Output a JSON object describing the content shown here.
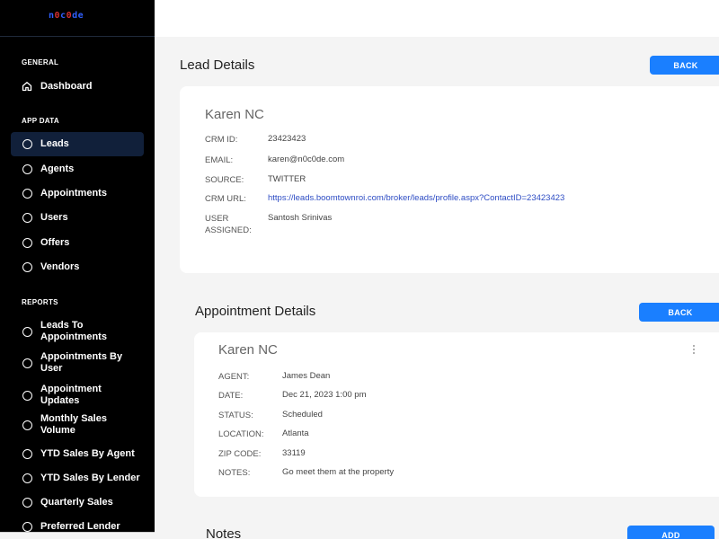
{
  "logo": {
    "p1": "n",
    "p2": "0",
    "p3": "c",
    "p4": "0",
    "p5": "de"
  },
  "sidebar": {
    "general_heading": "GENERAL",
    "dashboard": "Dashboard",
    "app_data_heading": "APP DATA",
    "app_items": [
      "Leads",
      "Agents",
      "Appointments",
      "Users",
      "Offers",
      "Vendors"
    ],
    "reports_heading": "REPORTS",
    "report_items": [
      "Leads To Appointments",
      "Appointments By User",
      "Appointment Updates",
      "Monthly Sales Volume",
      "YTD Sales By Agent",
      "YTD Sales By Lender",
      "Quarterly Sales",
      "Preferred Lender"
    ]
  },
  "lead": {
    "title": "Lead Details",
    "back_label": "BACK",
    "name": "Karen NC",
    "fields": [
      {
        "label": "CRM ID:",
        "value": "23423423"
      },
      {
        "label": "EMAIL:",
        "value": "karen@n0c0de.com"
      },
      {
        "label": "SOURCE:",
        "value": "TWITTER"
      },
      {
        "label": "CRM URL:",
        "value": "https://leads.boomtownroi.com/broker/leads/profile.aspx?ContactID=23423423"
      },
      {
        "label": "USER ASSIGNED:",
        "value": "Santosh Srinivas"
      }
    ]
  },
  "appointment": {
    "title": "Appointment Details",
    "back_label": "BACK",
    "name": "Karen NC",
    "fields": [
      {
        "label": "AGENT:",
        "value": "James Dean"
      },
      {
        "label": "DATE:",
        "value": "Dec 21, 2023 1:00 pm"
      },
      {
        "label": "STATUS:",
        "value": "Scheduled"
      },
      {
        "label": "LOCATION:",
        "value": "Atlanta"
      },
      {
        "label": "ZIP CODE:",
        "value": "33119"
      },
      {
        "label": "NOTES:",
        "value": "Go meet them at the property"
      }
    ]
  },
  "notes": {
    "title": "Notes",
    "add_label": "ADD"
  },
  "colors": {
    "accent": "#1a7fff",
    "sidebar_bg": "#000000",
    "active_bg": "#11203a",
    "link": "#2d4cc4"
  },
  "icons": {
    "dashboard": "home-icon",
    "nav": "circle-icon",
    "menu": "kebab-icon"
  }
}
